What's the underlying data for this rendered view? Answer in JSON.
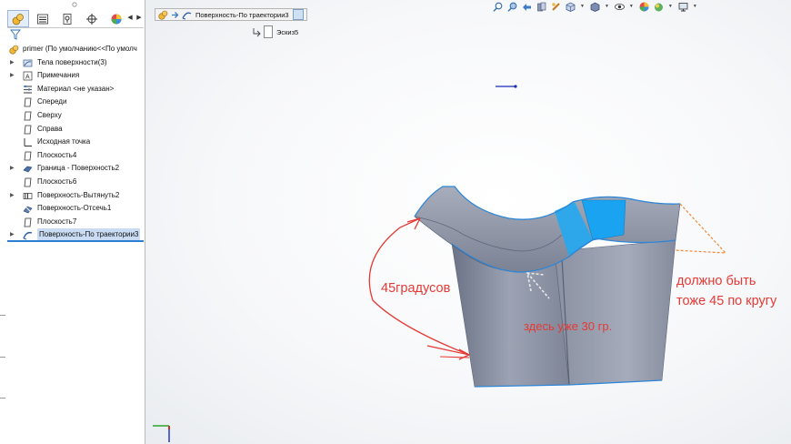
{
  "feature_tree": {
    "root_label": "primer  (По умолчанию<<По умолч",
    "items": [
      {
        "label": "Тела поверхности(3)",
        "icon": "surface-bodies-folder-icon",
        "expandable": true
      },
      {
        "label": "Примечания",
        "icon": "annotations-icon",
        "expandable": true
      },
      {
        "label": "Материал <не указан>",
        "icon": "material-icon",
        "expandable": false
      },
      {
        "label": "Спереди",
        "icon": "plane-icon",
        "expandable": false
      },
      {
        "label": "Сверху",
        "icon": "plane-icon",
        "expandable": false
      },
      {
        "label": "Справа",
        "icon": "plane-icon",
        "expandable": false
      },
      {
        "label": "Исходная точка",
        "icon": "origin-icon",
        "expandable": false
      },
      {
        "label": "Плоскость4",
        "icon": "plane-icon",
        "expandable": false
      },
      {
        "label": "Граница - Поверхность2",
        "icon": "boundary-surface-icon",
        "expandable": true
      },
      {
        "label": "Плоскость6",
        "icon": "plane-icon",
        "expandable": false
      },
      {
        "label": "Поверхность-Вытянуть2",
        "icon": "extruded-surface-icon",
        "expandable": true
      },
      {
        "label": "Поверхность-Отсечь1",
        "icon": "trim-surface-icon",
        "expandable": false
      },
      {
        "label": "Плоскость7",
        "icon": "plane-icon",
        "expandable": false
      },
      {
        "label": "Поверхность-По траектории3",
        "icon": "swept-surface-icon",
        "expandable": true,
        "selected": true
      }
    ]
  },
  "breadcrumb": {
    "label": "Поверхность-По траектории3",
    "sub_label": "Эскиз5"
  },
  "annotations": {
    "left": "45градусов",
    "middle": "здесь уже 30 гр.",
    "right_line1": "должно быть",
    "right_line2": "тоже 45 по кругу"
  },
  "colors": {
    "annotation_red": "#e53935",
    "annotation_orange": "#f08a3c",
    "surface_gray": "#8f97a8",
    "selection_blue": "#1aa3f0",
    "edge_blue": "#2f86d6"
  }
}
